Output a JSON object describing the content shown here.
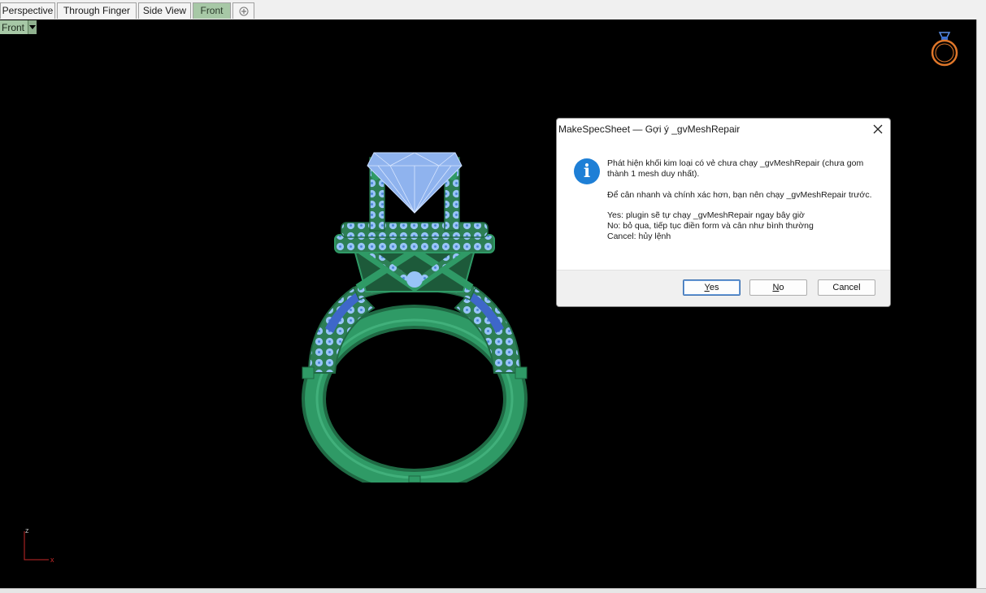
{
  "tabs": [
    {
      "label": "Perspective"
    },
    {
      "label": "Through Finger"
    },
    {
      "label": "Side View"
    },
    {
      "label": "Front"
    }
  ],
  "add_tab_icon": "plus-icon",
  "viewport": {
    "label": "Front",
    "background": "#000000"
  },
  "axes": {
    "z": "z",
    "x": "x"
  },
  "dialog": {
    "title": "MakeSpecSheet — Gợi ý _gvMeshRepair",
    "icon": "info-icon",
    "icon_glyph": "i",
    "message_line1": "Phát hiện khối kim loại có vẻ chưa chạy _gvMeshRepair (chưa gom thành 1 mesh duy nhất).",
    "message_line2": "Để cân nhanh và chính xác hơn, bạn nên chạy _gvMeshRepair trước.",
    "message_yes": "Yes: plugin sẽ tự chạy _gvMeshRepair ngay bây giờ",
    "message_no": "No: bỏ qua, tiếp tục điền form và cân như bình thường",
    "message_cancel": "Cancel: hủy lệnh",
    "buttons": {
      "yes": {
        "hotkey": "Y",
        "rest": "es"
      },
      "no": {
        "hotkey": "N",
        "rest": "o"
      },
      "cancel": "Cancel"
    }
  },
  "colors": {
    "tab_active": "#a7c8a6",
    "metal_green": "#2e8b5e",
    "gem_blue": "#8ab4f0",
    "dialog_accent": "#1e7fd6"
  }
}
